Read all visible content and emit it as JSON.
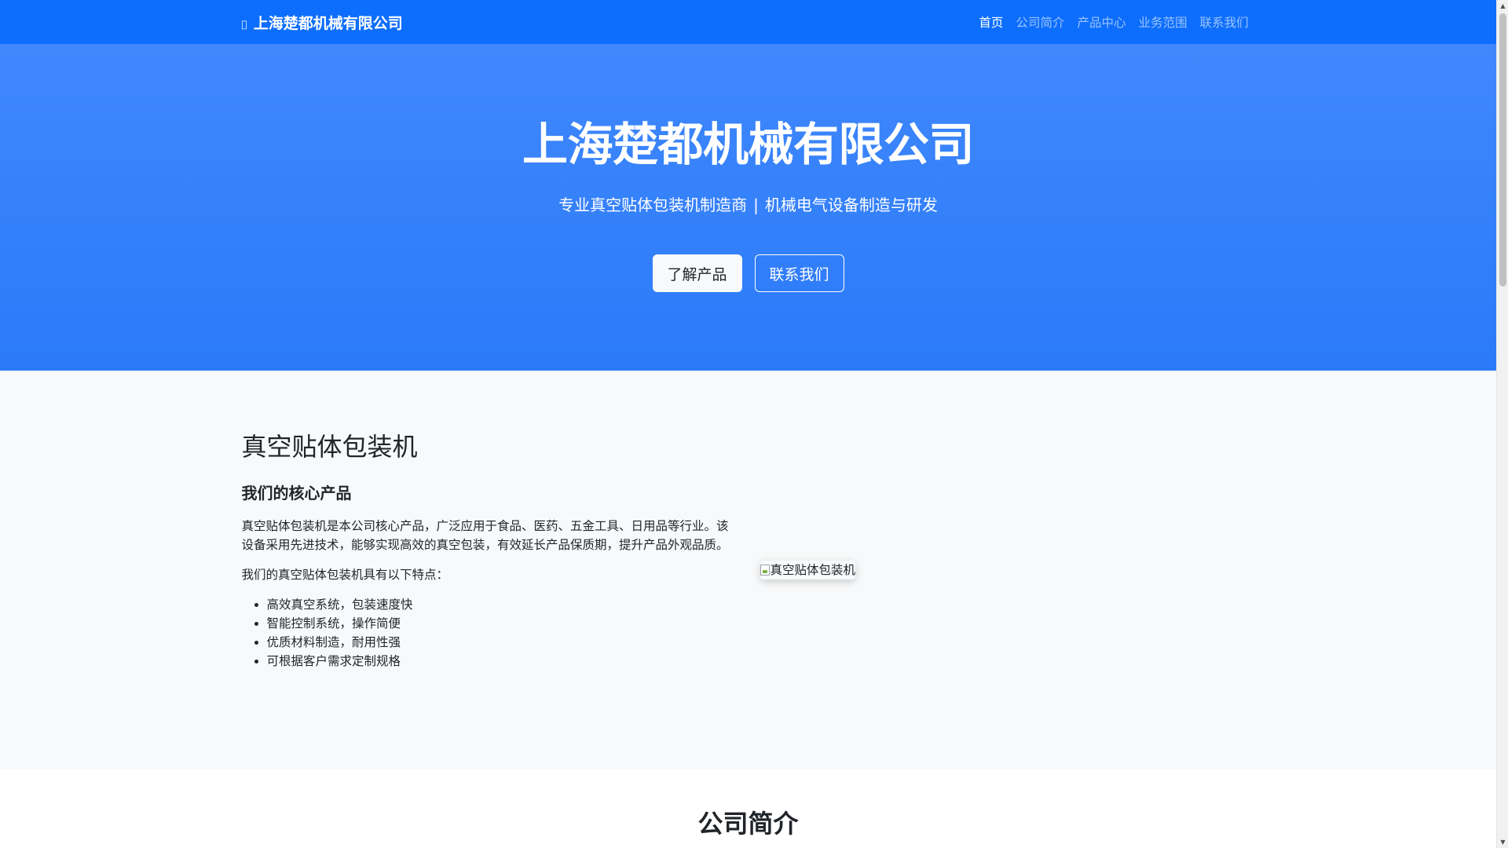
{
  "navbar": {
    "brand_icon": "industry-icon",
    "brand": "上海楚都机械有限公司",
    "items": [
      {
        "label": "首页",
        "active": true
      },
      {
        "label": "公司简介",
        "active": false
      },
      {
        "label": "产品中心",
        "active": false
      },
      {
        "label": "业务范围",
        "active": false
      },
      {
        "label": "联系我们",
        "active": false
      }
    ]
  },
  "hero": {
    "title": "上海楚都机械有限公司",
    "subtitle_left": "专业真空贴体包装机制造商",
    "subtitle_sep": "|",
    "subtitle_right": "机械电气设备制造与研发",
    "primary_button": "了解产品",
    "secondary_button": "联系我们"
  },
  "product": {
    "title": "真空贴体包装机",
    "subtitle": "我们的核心产品",
    "paragraph1": "真空贴体包装机是本公司核心产品，广泛应用于食品、医药、五金工具、日用品等行业。该设备采用先进技术，能够实现高效的真空包装，有效延长产品保质期，提升产品外观品质。",
    "paragraph2": "我们的真空贴体包装机具有以下特点：",
    "features": [
      "高效真空系统，包装速度快",
      "智能控制系统，操作简便",
      "优质材料制造，耐用性强",
      "可根据客户需求定制规格"
    ],
    "image_alt": "真空贴体包装机"
  },
  "about": {
    "title": "公司简介"
  },
  "colors": {
    "primary": "#0d6efd",
    "hero_top": "#4088fc",
    "hero_bottom": "#2b7af9",
    "section_bg": "#f8f9fa"
  }
}
